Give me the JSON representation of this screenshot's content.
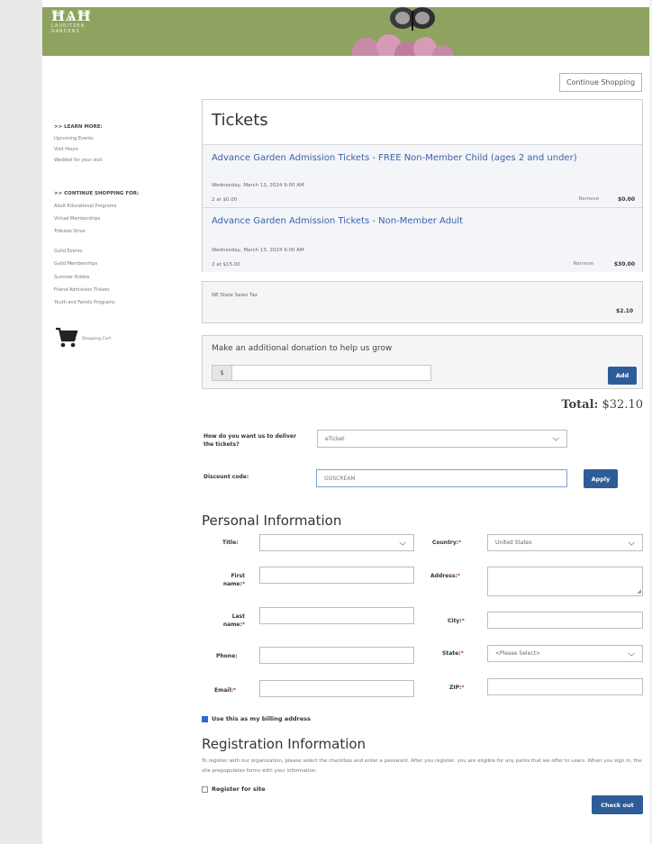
{
  "header": {
    "logo_text": "ĦѦĦ",
    "logo_subtitle_line1": "LAURITZEN",
    "logo_subtitle_line2": "GARDENS"
  },
  "top": {
    "continue_shopping_label": "Continue Shopping"
  },
  "left_nav": {
    "learn_more_heading": ">> LEARN MORE:",
    "learn_more_items": [
      "Upcoming Events",
      "Visit Hours",
      "Wedded for your visit"
    ],
    "continue_heading": ">> CONTINUE SHOPPING FOR:",
    "continue_items": [
      "Adult Educational Programs",
      "Virtual Memberships",
      "Tributes Drive",
      "Guild Events",
      "Guild Memberships",
      "Summer Kiddos",
      "Friend Admission Tickets",
      "Youth and Family Programs"
    ],
    "cart_label": "Shopping Cart"
  },
  "cart": {
    "title": "Tickets",
    "items": [
      {
        "name": "Advance Garden Admission Tickets - FREE Non-Member Child (ages 2 and under)",
        "date": "Wednesday, March 13, 2024 9:00 AM",
        "qty": "2 at $0.00",
        "remove": "Remove",
        "price": "$0.00"
      },
      {
        "name": "Advance Garden Admission Tickets - Non-Member Adult",
        "date": "Wednesday, March 13, 2024 9:00 AM",
        "qty": "2 at $15.00",
        "remove": "Remove",
        "price": "$30.00"
      }
    ],
    "tax_label": "NE State Sales Tax",
    "tax_amount": "$2.10",
    "donation_prompt": "Make an additional donation to help us grow",
    "donation_currency": "$",
    "add_label": "Add",
    "total_label": "Total:",
    "total_value": "$32.10"
  },
  "delivery": {
    "label": "How do you want us to deliver the tickets?",
    "value": "eTicket",
    "discount_label": "Discount code:",
    "discount_value": "GOSCREAM",
    "apply_label": "Apply"
  },
  "personal": {
    "title": "Personal Information",
    "title_label": "Title:",
    "country_label": "Country:",
    "country_value": "United States",
    "first_label": "First name:",
    "address_label": "Address:",
    "last_label": "Last name:",
    "city_label": "City:",
    "phone_label": "Phone:",
    "state_label": "State:",
    "state_value": "<Please Select>",
    "email_label": "Email:",
    "zip_label": "ZIP:",
    "billing_label": "Use this as my billing address"
  },
  "registration": {
    "title": "Registration Information",
    "text": "To register with our organization, please select the checkbox and enter a password. After you register, you are eligible for any perks that we offer to users. When you sign in, the site prepopulates forms with your information.",
    "register_label": "Register for site",
    "checkout_label": "Check out"
  },
  "colors": {
    "banner": "#8ea35f",
    "link": "#3a62a8",
    "button": "#2e5c99"
  }
}
